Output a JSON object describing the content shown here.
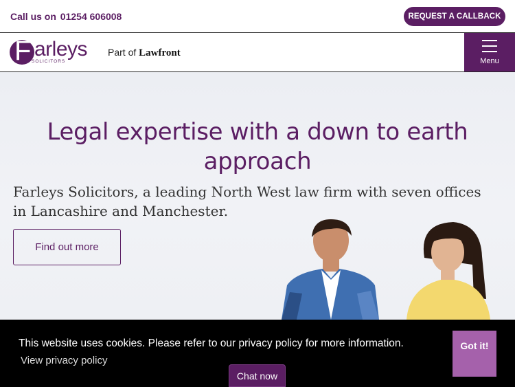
{
  "topbar": {
    "call_label": "Call us on",
    "phone": "01254 606008",
    "callback_label": "REQUEST A CALLBACK"
  },
  "header": {
    "logo": {
      "initial": "F",
      "rest": "arleys",
      "sub": "SOLICITORS"
    },
    "part_of_prefix": "Part of",
    "part_of_brand": "Lawfront",
    "menu_label": "Menu"
  },
  "hero": {
    "title": "Legal expertise with a down to earth approach",
    "subtitle": "Farleys Solicitors, a leading North West law firm with seven offices in Lancashire and Manchester.",
    "cta_label": "Find out more"
  },
  "cookie": {
    "message": "This website uses cookies. Please refer to our privacy policy for more information.",
    "link_label": "View privacy policy",
    "accept_label": "Got it!"
  },
  "chat": {
    "label": "Chat now"
  },
  "colors": {
    "brand": "#5b1e63",
    "accent": "#a561ab",
    "cookie_bg": "#000000"
  },
  "icons": [
    "hamburger-menu-icon"
  ]
}
